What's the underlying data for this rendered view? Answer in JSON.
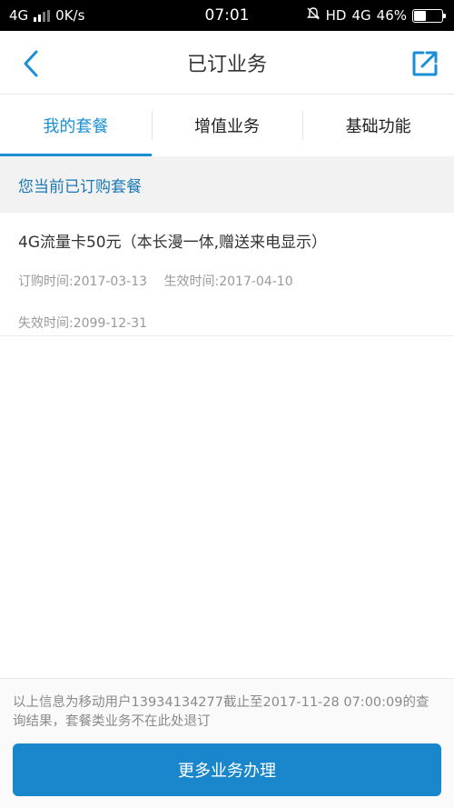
{
  "status_bar": {
    "network": "4G",
    "speed": "0K/s",
    "time": "07:01",
    "hd": "HD",
    "network_right": "4G",
    "battery": "46%",
    "battery_level": 0.46
  },
  "header": {
    "title": "已订业务",
    "back_icon": "chevron-left-icon",
    "share_icon": "external-link-icon"
  },
  "tabs": [
    {
      "label": "我的套餐",
      "active": true
    },
    {
      "label": "增值业务",
      "active": false
    },
    {
      "label": "基础功能",
      "active": false
    }
  ],
  "section": {
    "title": "您当前已订购套餐"
  },
  "package": {
    "name": "4G流量卡50元（本长漫一体,赠送来电显示）",
    "order_time": "订购时间:2017-03-13",
    "effective_time": "生效时间:2017-04-10",
    "expire_time": "失效时间:2099-12-31"
  },
  "footer": {
    "note": "以上信息为移动用户13934134277截止至2017-11-28 07:00:09的查询结果，套餐类业务不在此处退订",
    "button_label": "更多业务办理"
  },
  "colors": {
    "accent": "#1a8fd6",
    "button": "#1a87cc",
    "section_text": "#1a78b4"
  }
}
